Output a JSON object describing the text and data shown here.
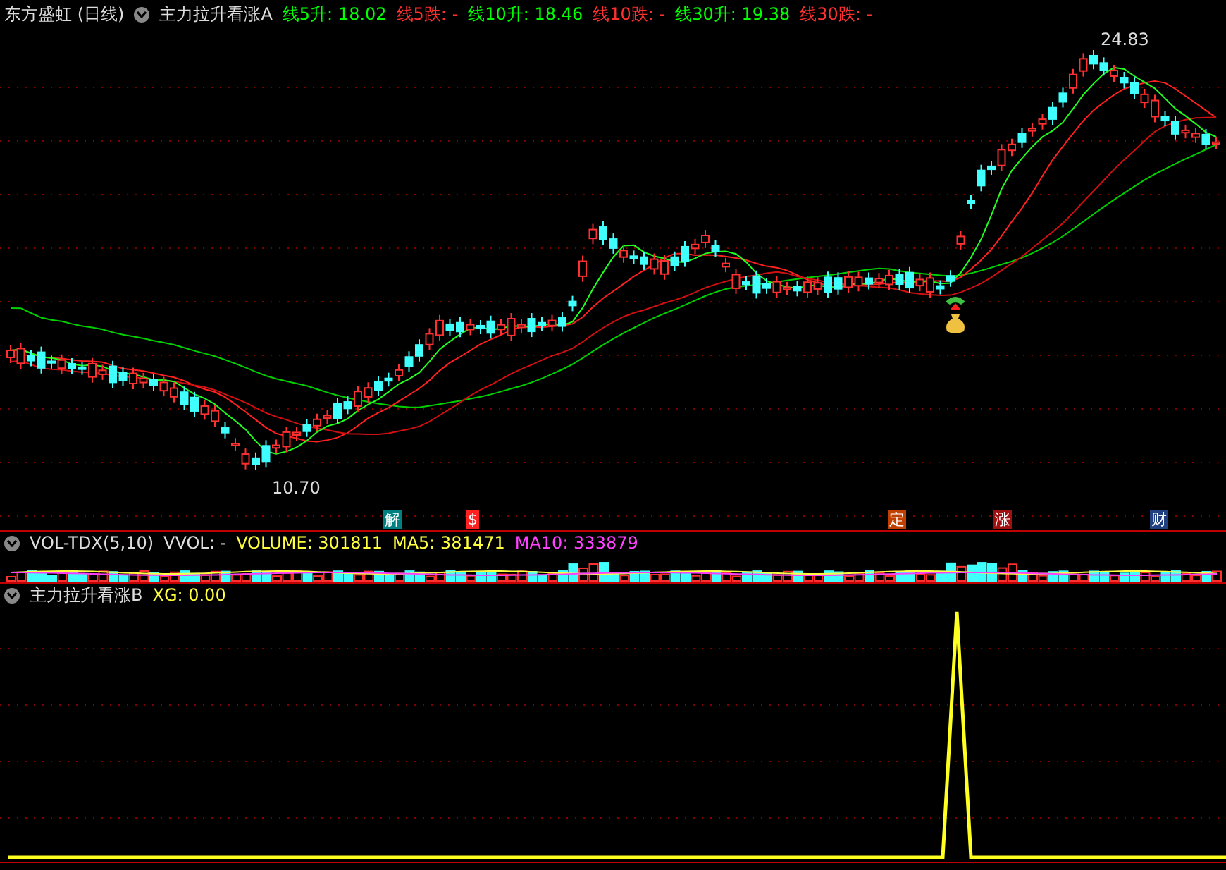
{
  "header": {
    "stock_name": "东方盛虹",
    "period": "(日线)",
    "indicator": "主力拉升看涨A",
    "values": [
      {
        "label": "线5升:",
        "value": "18.02",
        "color": "#00ff00"
      },
      {
        "label": "线5跌:",
        "value": "-",
        "color": "#ff3030"
      },
      {
        "label": "线10升:",
        "value": "18.46",
        "color": "#00ff00"
      },
      {
        "label": "线10跌:",
        "value": "-",
        "color": "#ff3030"
      },
      {
        "label": "线30升:",
        "value": "19.38",
        "color": "#00ff00"
      },
      {
        "label": "线30跌:",
        "value": "-",
        "color": "#ff3030"
      }
    ]
  },
  "main_chart": {
    "high_label": "24.83",
    "low_label": "10.70",
    "events": [
      {
        "label": "解",
        "color": "#008080"
      },
      {
        "label": "$",
        "color": "#ff2020"
      },
      {
        "label": "定",
        "color": "#c04000"
      },
      {
        "label": "涨",
        "color": "#a01010"
      },
      {
        "label": "财",
        "color": "#204080"
      }
    ]
  },
  "volume_panel": {
    "title": "VOL-TDX(5,10)",
    "values": [
      {
        "text": "VVOL: -",
        "color": "#e0e0e0"
      },
      {
        "text": "VOLUME: 301811",
        "color": "#ffff40"
      },
      {
        "text": "MA5: 381471",
        "color": "#ffff40"
      },
      {
        "text": "MA10: 333879",
        "color": "#ff40ff"
      }
    ]
  },
  "signal_panel": {
    "title": "主力拉升看涨B",
    "value": "XG: 0.00"
  }
}
